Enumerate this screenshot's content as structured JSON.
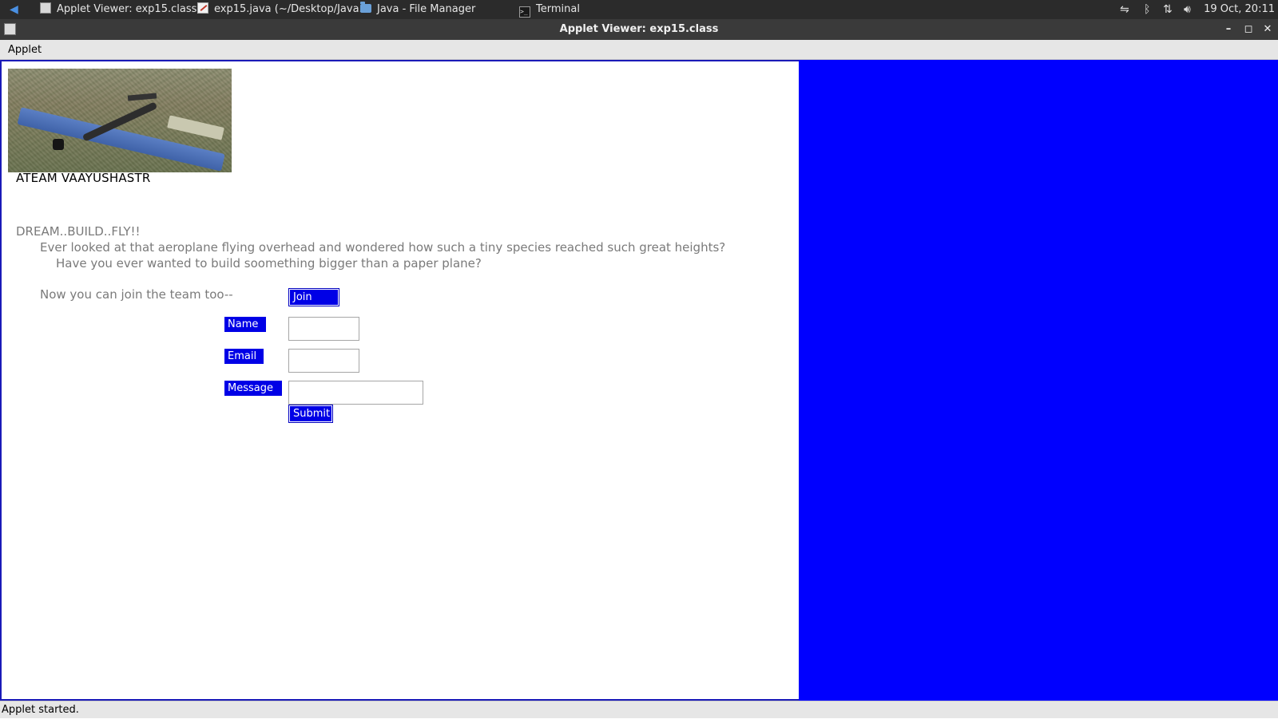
{
  "taskbar": {
    "items": [
      {
        "label": "Applet Viewer: exp15.class",
        "icon": "applet-icon"
      },
      {
        "label": "exp15.java (~/Desktop/Java...",
        "icon": "text-editor-icon"
      },
      {
        "label": "Java - File Manager",
        "icon": "folder-icon"
      },
      {
        "label": "Terminal",
        "icon": "terminal-icon"
      }
    ],
    "tray_icons": [
      "network-wired-icon",
      "bluetooth-icon",
      "network-transfer-icon",
      "volume-icon"
    ],
    "clock": "19 Oct, 20:11"
  },
  "window": {
    "title": "Applet Viewer: exp15.class",
    "controls": [
      "minimize",
      "maximize",
      "close"
    ]
  },
  "menu": {
    "applet_label": "Applet"
  },
  "applet": {
    "logo_text": "ATEAM VAAYUSHASTR",
    "tagline": "DREAM..BUILD..FLY!!",
    "paragraph_1": "Ever looked at that aeroplane flying overhead and wondered how such a tiny species reached such great heights?",
    "paragraph_2": "Have you ever wanted to build soomething bigger than a paper plane?",
    "join_text": "Now you can join the team too--",
    "join_button": "Join now",
    "form": {
      "name_label": "Name :",
      "name_value": "",
      "email_label": "Email :",
      "email_value": "",
      "message_label": "Message :",
      "message_value": "",
      "submit_label": "Submit"
    },
    "accent_color": "#0000ff"
  },
  "status": {
    "text": "Applet started."
  }
}
